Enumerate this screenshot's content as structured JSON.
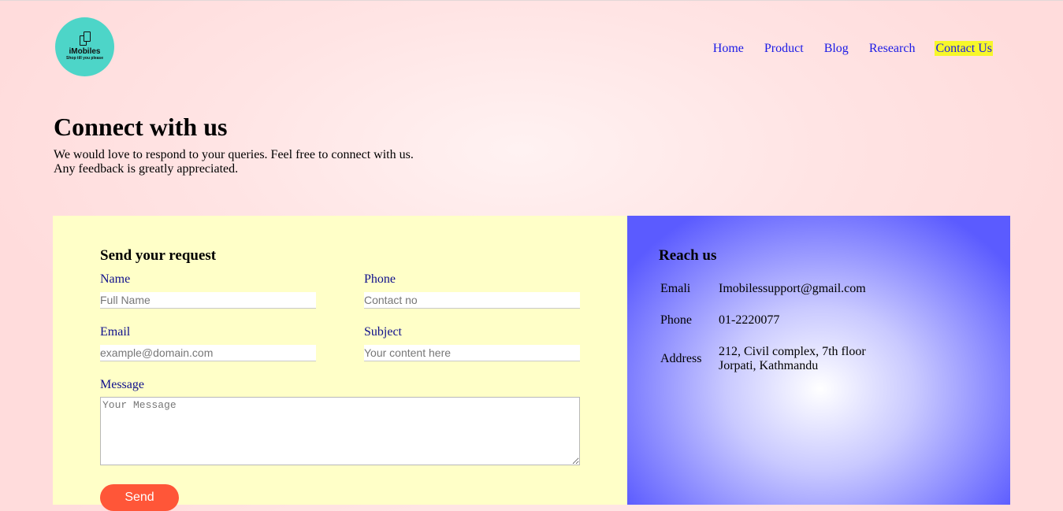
{
  "brand": {
    "name": "iMobiles",
    "tagline": "Shop till you please",
    "logo_color": "#4dd5c8"
  },
  "nav": {
    "items": [
      {
        "label": "Home",
        "active": false
      },
      {
        "label": "Product",
        "active": false
      },
      {
        "label": "Blog",
        "active": false
      },
      {
        "label": "Research",
        "active": false
      },
      {
        "label": "Contact Us",
        "active": true
      }
    ]
  },
  "hero": {
    "title": "Connect with us",
    "line1": "We would love to respond to your queries. Feel free to connect with us.",
    "line2": "Any feedback is greatly appreciated."
  },
  "form": {
    "title": "Send your request",
    "name_label": "Name",
    "name_placeholder": "Full Name",
    "phone_label": "Phone",
    "phone_placeholder": "Contact no",
    "email_label": "Email",
    "email_placeholder": "example@domain.com",
    "subject_label": "Subject",
    "subject_placeholder": "Your content here",
    "message_label": "Message",
    "message_placeholder": "Your Message",
    "send_label": "Send"
  },
  "reach": {
    "title": "Reach us",
    "email_label": "Emali",
    "email_value": "Imobilessupport@gmail.com",
    "phone_label": "Phone",
    "phone_value": "01-2220077",
    "address_label": "Address",
    "address_line1": "212, Civil complex, 7th floor",
    "address_line2": "Jorpati, Kathmandu"
  },
  "colors": {
    "nav_link": "#1a1ae6",
    "active_highlight": "#f7f72a",
    "form_bg": "#ffffc8",
    "info_bg": "#5b5bff",
    "send_button": "#ff5638",
    "form_label": "#0f0f8c"
  }
}
